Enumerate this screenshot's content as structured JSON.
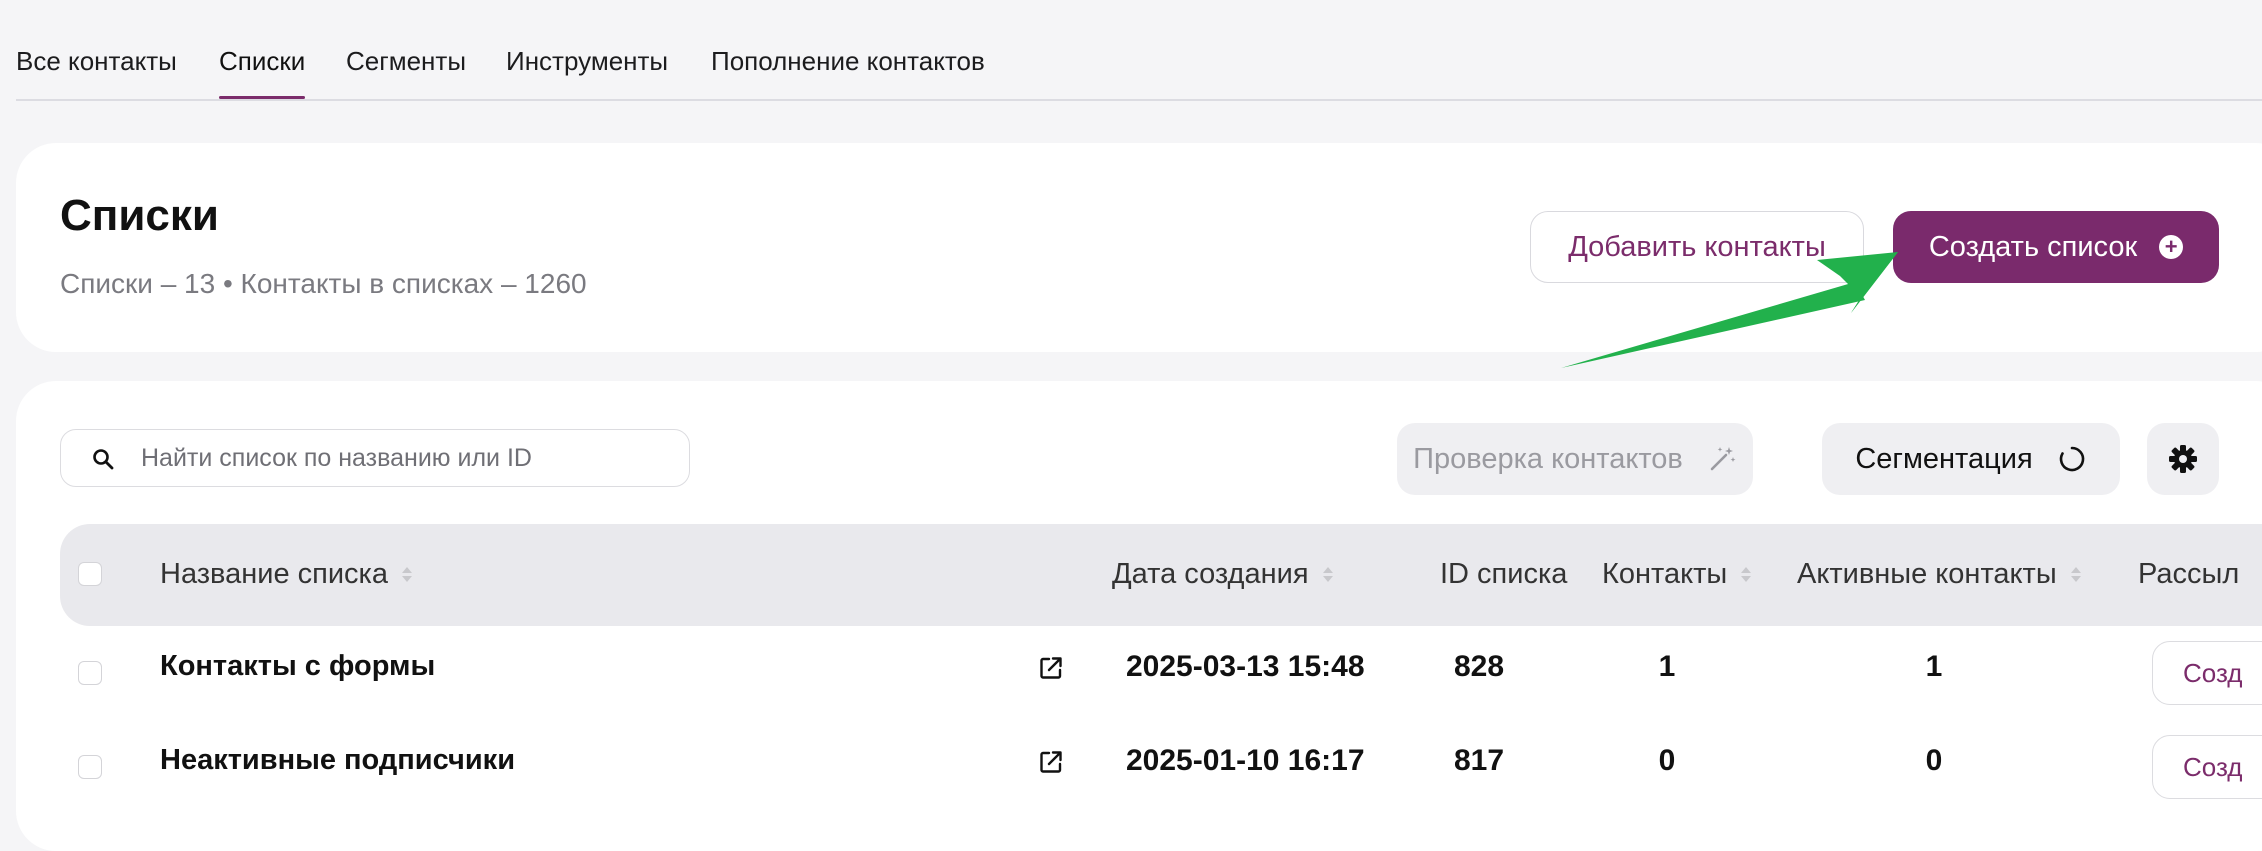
{
  "tabs": [
    {
      "label": "Все контакты"
    },
    {
      "label": "Списки"
    },
    {
      "label": "Сегменты"
    },
    {
      "label": "Инструменты"
    },
    {
      "label": "Пополнение контактов"
    }
  ],
  "header": {
    "title": "Списки",
    "subtitle": "Списки – 13 • Контакты в списках – 1260",
    "add_contacts_label": "Добавить контакты",
    "create_list_label": "Создать список"
  },
  "toolbar": {
    "search_placeholder": "Найти список по названию или ID",
    "check_contacts_label": "Проверка контактов",
    "segmentation_label": "Сегментация"
  },
  "table": {
    "columns": {
      "name": "Название списка",
      "created": "Дата создания",
      "id": "ID списка",
      "contacts": "Контакты",
      "active": "Активные контакты",
      "mailings": "Рассыл"
    },
    "rows": [
      {
        "name": "Контакты с формы",
        "created": "2025-03-13 15:48",
        "id": "828",
        "contacts": "1",
        "active": "1",
        "action": "Созд"
      },
      {
        "name": "Неактивные подписчики",
        "created": "2025-01-10 16:17",
        "id": "817",
        "contacts": "0",
        "active": "0",
        "action": "Созд"
      }
    ]
  },
  "colors": {
    "accent": "#7a2a6c",
    "annotation_arrow": "#22b14c"
  }
}
